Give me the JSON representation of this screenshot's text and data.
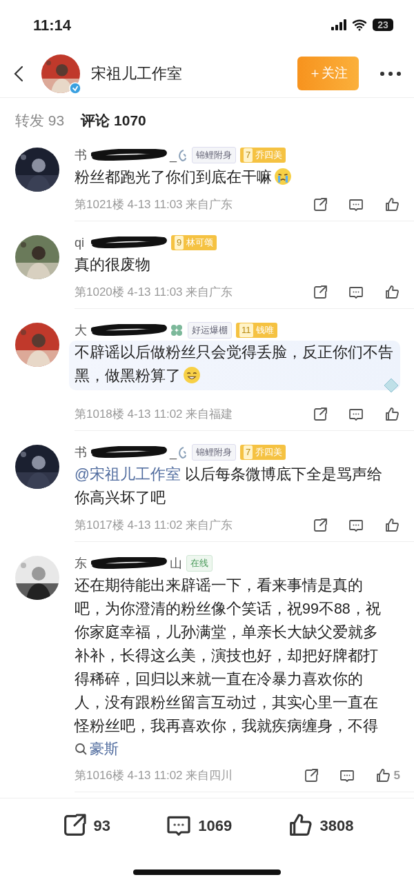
{
  "status_bar": {
    "time": "11:14",
    "battery": "23"
  },
  "header": {
    "title": "宋祖儿工作室",
    "verified": true,
    "follow_button": "＋关注"
  },
  "tabs": [
    {
      "label": "转发 93",
      "selected": false
    },
    {
      "label": "评论 1070",
      "selected": true
    }
  ],
  "comments": [
    {
      "name": "书",
      "name_tail": "_",
      "badges": [
        {
          "kind": "fan",
          "label": "锦鲤附身"
        },
        {
          "kind": "level",
          "level_text": "7",
          "label": "乔四美"
        }
      ],
      "text": "粉丝都跑光了你们到底在干嘛",
      "emoji": {
        "kind": "crying"
      },
      "highlighted": false,
      "meta": "第1021楼 4-13 11:03 来自广东"
    },
    {
      "name": "qi",
      "badges": [
        {
          "kind": "level",
          "level_text": "9",
          "label": "林可颂"
        }
      ],
      "text": "真的很废物",
      "highlighted": false,
      "meta": "第1020楼 4-13 11:03 来自广东"
    },
    {
      "name": "大",
      "badges": [
        {
          "kind": "luck",
          "label": "好运爆棚"
        },
        {
          "kind": "level",
          "level_text": "11",
          "label": "钱唯"
        }
      ],
      "text": "不辟谣以后做粉丝只会觉得丢脸，反正你们不告黑，做黑粉算了",
      "emoji": {
        "kind": "smile"
      },
      "highlighted": true,
      "meta": "第1018楼 4-13 11:02 来自福建"
    },
    {
      "name": "书",
      "name_tail": "_",
      "badges": [
        {
          "kind": "fan",
          "label": "锦鲤附身"
        },
        {
          "kind": "level",
          "level_text": "7",
          "label": "乔四美"
        }
      ],
      "mention": "@宋祖儿工作室",
      "text": " 以后每条微博底下全是骂声给你高兴坏了吧",
      "highlighted": false,
      "meta": "第1017楼 4-13 11:02 来自广东"
    },
    {
      "name": "东",
      "name_tail": "山",
      "badges": [
        {
          "kind": "online",
          "label": "在线"
        }
      ],
      "text": "还在期待能出来辟谣一下，看来事情是真的吧，为你澄清的粉丝像个笑话，祝99不88，祝你家庭幸福，儿孙满堂，单亲长大缺父爱就多补补，长得这么美，演技也好，却把好牌都打得稀碎，回归以来就一直在冷暴力喜欢你的人，没有跟粉丝留言互动过，其实心里一直在怪粉丝吧，我再喜欢你，我就疾病缠身，不得",
      "search_link": "豪斯",
      "highlighted": false,
      "meta": "第1016楼 4-13 11:02 来自四川",
      "likes": "5"
    }
  ],
  "bottom_bar": {
    "reposts": "93",
    "comments": "1069",
    "likes": "3808"
  }
}
